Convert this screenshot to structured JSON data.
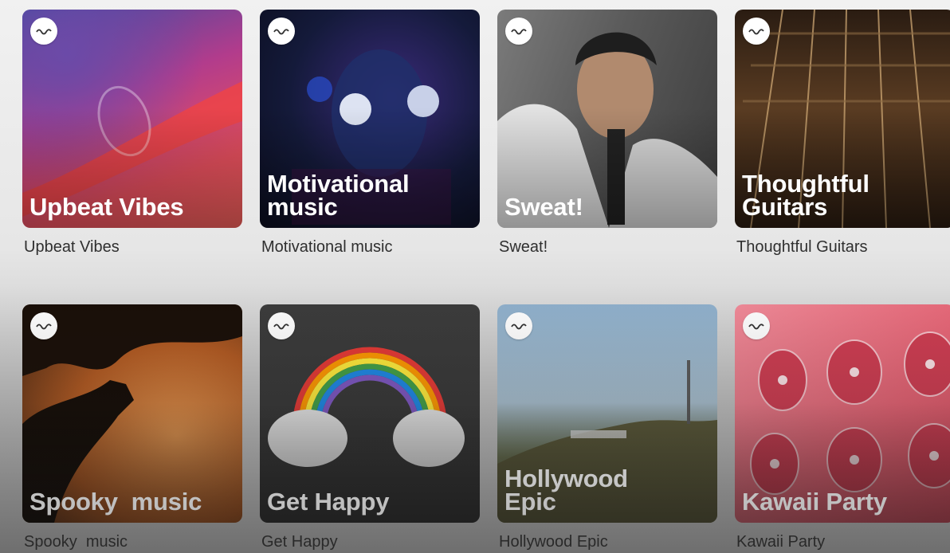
{
  "playlists": [
    {
      "card_title": "Upbeat Vibes",
      "caption": "Upbeat Vibes",
      "icon": "waveform-icon"
    },
    {
      "card_title": "Motivational\nmusic",
      "caption": "Motivational music",
      "icon": "waveform-icon"
    },
    {
      "card_title": "Sweat!",
      "caption": "Sweat!",
      "icon": "waveform-icon"
    },
    {
      "card_title": "Thoughtful\nGuitars",
      "caption": "Thoughtful Guitars",
      "icon": "waveform-icon"
    },
    {
      "card_title": "Spooky  music",
      "caption": "Spooky  music",
      "icon": "waveform-icon"
    },
    {
      "card_title": "Get Happy",
      "caption": "Get Happy",
      "icon": "waveform-icon"
    },
    {
      "card_title": "Hollywood\nEpic",
      "caption": "Hollywood Epic",
      "icon": "waveform-icon"
    },
    {
      "card_title": "Kawaii Party",
      "caption": "Kawaii Party",
      "icon": "waveform-icon"
    }
  ],
  "colors": {
    "upbeat": [
      "#3a3a8c",
      "#c8367a",
      "#f04b5c"
    ],
    "motivational": [
      "#121629",
      "#1c2a6e",
      "#7a1a4a"
    ],
    "sweat": [
      "#4d4d4d",
      "#bdbdbd",
      "#2c2c2c"
    ],
    "guitars": [
      "#1a120c",
      "#6b4a2a",
      "#2a1d12"
    ],
    "spooky": [
      "#2a1a10",
      "#c0682a",
      "#f0a050"
    ],
    "happy": [
      "#3a3a3a",
      "#4a4a4a",
      "#2e2e2e"
    ],
    "hollywood": [
      "#8fb0d0",
      "#6a7a5a",
      "#4a4a2a"
    ],
    "kawaii": [
      "#e8707e",
      "#d94f62",
      "#f39aa5"
    ]
  }
}
